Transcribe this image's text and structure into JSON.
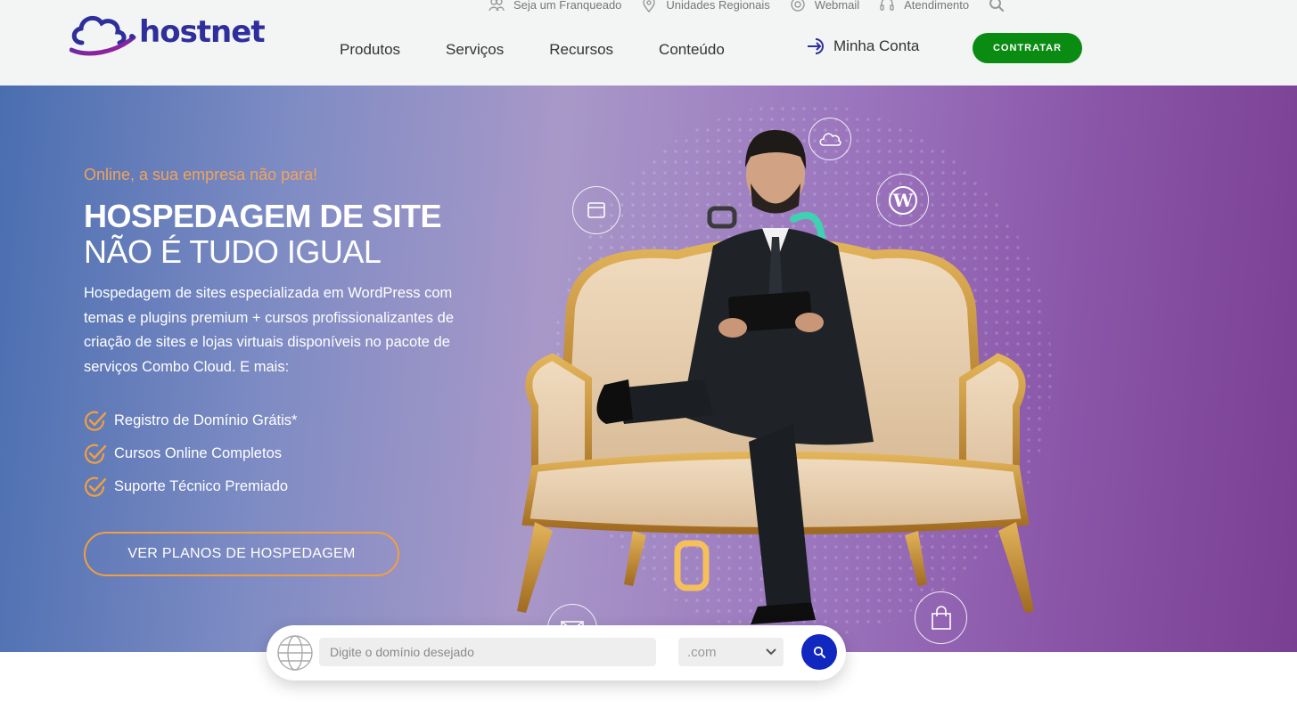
{
  "brand": {
    "name": "hostnet"
  },
  "topbar": {
    "items": [
      {
        "label": "Seja um Franqueado",
        "icon": "people-icon"
      },
      {
        "label": "Unidades Regionais",
        "icon": "location-pin-icon"
      },
      {
        "label": "Webmail",
        "icon": "mail-at-icon"
      },
      {
        "label": "Atendimento",
        "icon": "headset-icon"
      }
    ],
    "search_icon": "search-icon"
  },
  "nav": {
    "items": [
      "Produtos",
      "Serviços",
      "Recursos",
      "Conteúdo"
    ],
    "account_label": "Minha Conta",
    "cta_label": "CONTRATAR"
  },
  "hero": {
    "kicker": "Online, a sua empresa não para!",
    "title_line1": "HOSPEDAGEM DE SITE",
    "title_line2": "NÃO É TUDO IGUAL",
    "description": "Hospedagem de sites especializada em WordPress com temas e plugins premium + cursos profissionalizantes de criação de sites e lojas virtuais disponíveis no pacote de serviços Combo Cloud. E mais:",
    "benefits": [
      "Registro de Domínio Grátis*",
      "Cursos Online Completos",
      "Suporte Técnico Premiado"
    ],
    "cta_label": "VER PLANOS DE HOSPEDAGEM"
  },
  "domain_search": {
    "placeholder": "Digite o domínio desejado",
    "tld_selected": ".com"
  },
  "colors": {
    "brand_blue": "#2f2f9b",
    "cta_green": "#0a8c12",
    "accent_orange": "#f0a45a",
    "search_blue": "#1027c0"
  }
}
